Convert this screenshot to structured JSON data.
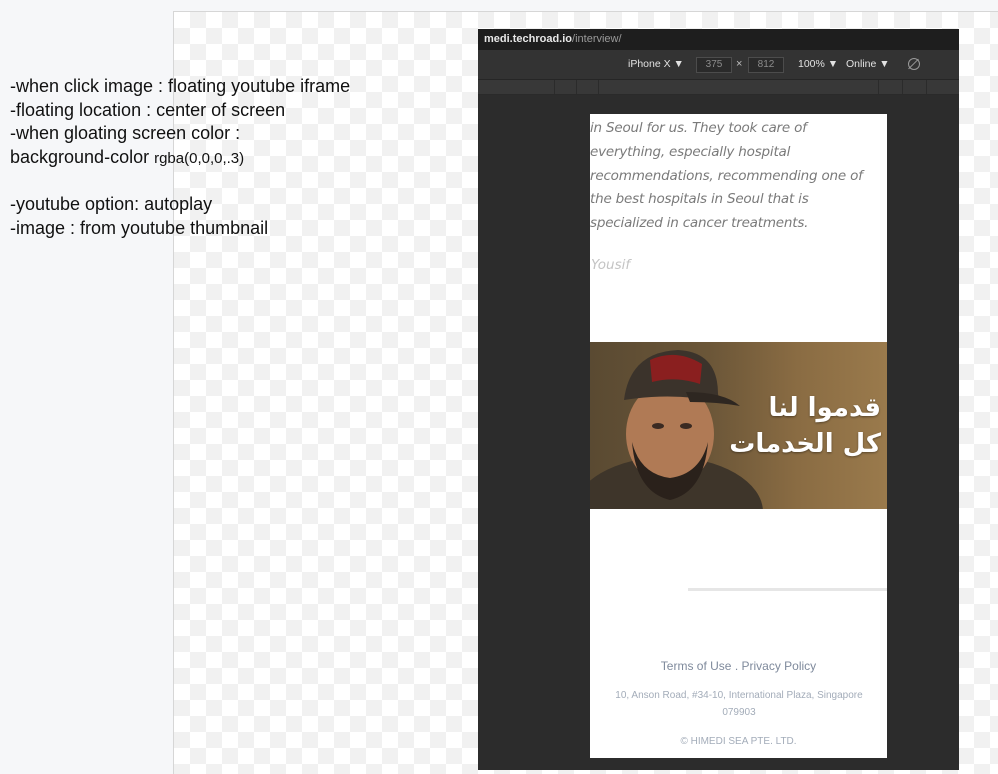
{
  "notes": {
    "line1": "-when click image : floating youtube iframe",
    "line2": "-floating location : center of screen",
    "line3": "-when gloating screen color :",
    "line4_prefix": "background-color ",
    "line4_value": "rgba(0,0,0,.3)",
    "line5": "-youtube option: autoplay",
    "line6": "-image : from youtube thumbnail"
  },
  "devtools": {
    "url_host": "medi.techroad.io",
    "url_path": "/interview/",
    "device": "iPhone X ▼",
    "width": "375",
    "separator": "×",
    "height": "812",
    "zoom": "100% ▼",
    "network": "Online ▼"
  },
  "content": {
    "quote_lines": [
      "in Seoul for us. They took care of",
      "everything, especially hospital",
      "recommendations, recommending one of",
      "the best hospitals in Seoul that is",
      "specialized in cancer treatments."
    ],
    "author": "Yousif",
    "video_caption_line1": "قدموا لنا",
    "video_caption_line2": "كل الخدمات"
  },
  "footer": {
    "terms": "Terms of Use",
    "separator": " . ",
    "privacy": "Privacy Policy",
    "address_line1": "10, Anson Road, #34-10, International Plaza, Singapore",
    "address_line2": "079903",
    "copyright": "© HIMEDI SEA PTE. LTD."
  },
  "colors": {
    "devtools_bg": "#2c2c2c",
    "thumb_bg": "#6b5638",
    "footer_link": "#7f8a9c"
  }
}
